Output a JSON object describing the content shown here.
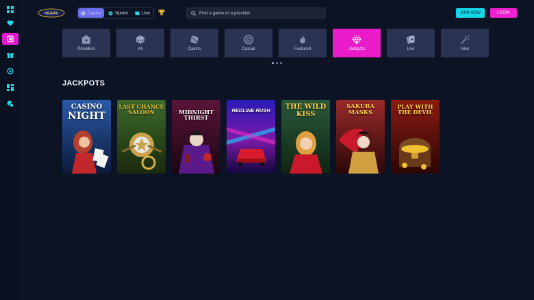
{
  "header": {
    "logo_text": "VEGAS",
    "modes": [
      {
        "label": "Casino",
        "icon": "casino-chip-icon",
        "active": true
      },
      {
        "label": "Sports",
        "icon": "soccer-ball-icon",
        "active": false
      },
      {
        "label": "Live",
        "icon": "live-cards-icon",
        "active": false
      }
    ],
    "search_placeholder": "Find a game or a provider",
    "join_label": "JOIN NOW",
    "login_label": "LOGIN"
  },
  "sidebar": {
    "items": [
      {
        "icon": "grid-icon",
        "active": false
      },
      {
        "icon": "heart-icon",
        "active": false
      },
      {
        "icon": "casino-icon",
        "active": true
      },
      {
        "icon": "gift-icon",
        "active": false
      },
      {
        "icon": "globe-icon",
        "active": false
      },
      {
        "icon": "dashboard-icon",
        "active": false
      },
      {
        "icon": "chat-icon",
        "active": false
      }
    ]
  },
  "categories": [
    {
      "label": "Providers",
      "icon": "play-box-icon",
      "active": false
    },
    {
      "label": "All",
      "icon": "dice-icon",
      "active": false
    },
    {
      "label": "Casino",
      "icon": "dice-single-icon",
      "active": false
    },
    {
      "label": "Casual",
      "icon": "chip-icon",
      "active": false
    },
    {
      "label": "Featured",
      "icon": "flame-icon",
      "active": false
    },
    {
      "label": "Jackpots",
      "icon": "diamond-icon",
      "active": true
    },
    {
      "label": "Live",
      "icon": "cards-icon",
      "active": false
    },
    {
      "label": "New",
      "icon": "firework-icon",
      "active": false
    }
  ],
  "section_title": "JACKPOTS",
  "games": [
    {
      "title": "Casino Night",
      "colors": [
        "#1d3f7a",
        "#0c1a3a"
      ]
    },
    {
      "title": "Last Chance Saloon",
      "colors": [
        "#3c5a1f",
        "#1a2a0c"
      ]
    },
    {
      "title": "Midnight Thirst",
      "colors": [
        "#4a1030",
        "#1a0612"
      ]
    },
    {
      "title": "Redline Rush",
      "colors": [
        "#3a12a8",
        "#12083c"
      ]
    },
    {
      "title": "The Wild Kiss",
      "colors": [
        "#1f4a2a",
        "#0e2412"
      ]
    },
    {
      "title": "Sakura Masks",
      "colors": [
        "#7a1a1a",
        "#2a0808"
      ]
    },
    {
      "title": "Play With The Devil",
      "colors": [
        "#7a1410",
        "#2a0604"
      ]
    }
  ]
}
